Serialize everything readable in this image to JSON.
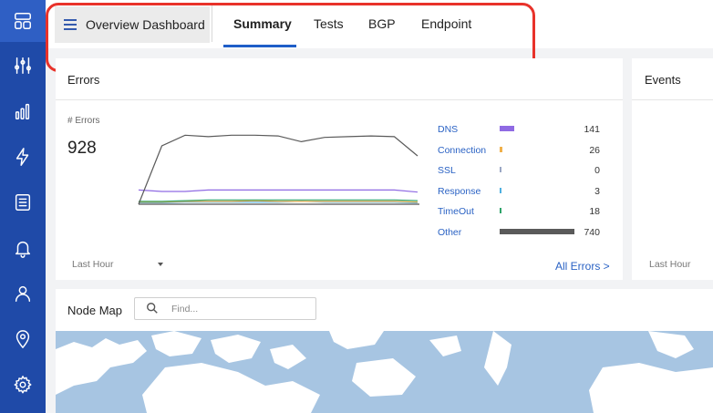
{
  "sidebar": {
    "items": [
      {
        "icon": "grid-icon",
        "active": true
      },
      {
        "icon": "sliders-icon"
      },
      {
        "icon": "bar-chart-icon"
      },
      {
        "icon": "lightning-icon"
      },
      {
        "icon": "list-doc-icon"
      },
      {
        "icon": "bell-icon"
      },
      {
        "icon": "user-icon"
      },
      {
        "icon": "location-pin-icon"
      },
      {
        "icon": "gear-icon"
      }
    ]
  },
  "header": {
    "dashboard_title": "Overview Dashboard",
    "tabs": [
      {
        "label": "Summary",
        "active": true
      },
      {
        "label": "Tests"
      },
      {
        "label": "BGP"
      },
      {
        "label": "Endpoint"
      }
    ]
  },
  "errors_card": {
    "title": "Errors",
    "metric_label": "# Errors",
    "metric_value": "928",
    "time_select": "Last Hour",
    "all_link": "All Errors >",
    "legend": [
      {
        "name": "DNS",
        "count": "141",
        "color": "#8f6ae3",
        "value": 141
      },
      {
        "name": "Connection",
        "count": "26",
        "color": "#f0b04a",
        "value": 26
      },
      {
        "name": "SSL",
        "count": "0",
        "color": "#9aa7c4",
        "value": 0
      },
      {
        "name": "Response",
        "count": "3",
        "color": "#4fb0e0",
        "value": 3
      },
      {
        "name": "TimeOut",
        "count": "18",
        "color": "#2ea46a",
        "value": 18
      },
      {
        "name": "Other",
        "count": "740",
        "color": "#5a5a5a",
        "value": 740
      }
    ]
  },
  "events_card": {
    "title": "Events",
    "time_select": "Last Hour"
  },
  "node_map": {
    "title": "Node Map",
    "search_placeholder": "Find..."
  },
  "chart_data": {
    "type": "line",
    "series": [
      {
        "name": "Other",
        "color": "#5a5a5a",
        "values": [
          0,
          82,
          97,
          95,
          97,
          97,
          96,
          88,
          94,
          95,
          96,
          95,
          68
        ]
      },
      {
        "name": "DNS",
        "color": "#8f6ae3",
        "values": [
          20,
          18,
          18,
          20,
          20,
          20,
          20,
          20,
          20,
          20,
          20,
          20,
          17
        ]
      },
      {
        "name": "TimeOut",
        "color": "#2ea46a",
        "values": [
          4,
          4,
          5,
          6,
          6,
          6,
          6,
          6,
          6,
          6,
          6,
          6,
          5
        ]
      },
      {
        "name": "Connection",
        "color": "#f0b04a",
        "values": [
          3,
          3,
          4,
          4,
          4,
          5,
          4,
          4,
          4,
          4,
          4,
          4,
          3
        ]
      },
      {
        "name": "Response",
        "color": "#4fb0e0",
        "values": [
          2,
          2,
          3,
          3,
          3,
          3,
          3,
          4,
          3,
          3,
          3,
          3,
          2
        ]
      }
    ],
    "ylim": [
      0,
      100
    ]
  },
  "colors": {
    "sidebar": "#1f4aa8",
    "accent": "#1f5ec8",
    "link": "#2a62c4",
    "highlight": "#e8322a"
  }
}
